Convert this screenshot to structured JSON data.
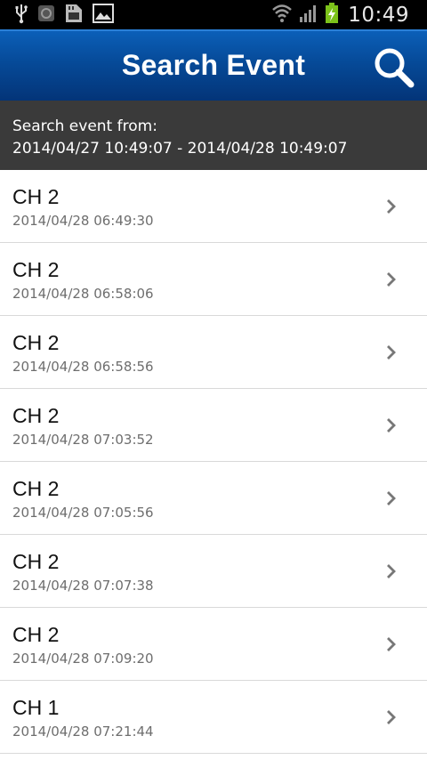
{
  "status_bar": {
    "time": "10:49",
    "icons": [
      "usb-icon",
      "notification-icon",
      "sd-card-icon",
      "image-icon",
      "wifi-icon",
      "signal-icon",
      "battery-charging-icon"
    ]
  },
  "header": {
    "title": "Search Event",
    "search_icon": "search-icon"
  },
  "range": {
    "label": "Search event from:",
    "value": "2014/04/27 10:49:07 - 2014/04/28 10:49:07"
  },
  "events": [
    {
      "channel": "CH 2",
      "time": "2014/04/28 06:49:30"
    },
    {
      "channel": "CH 2",
      "time": "2014/04/28 06:58:06"
    },
    {
      "channel": "CH 2",
      "time": "2014/04/28 06:58:56"
    },
    {
      "channel": "CH 2",
      "time": "2014/04/28 07:03:52"
    },
    {
      "channel": "CH 2",
      "time": "2014/04/28 07:05:56"
    },
    {
      "channel": "CH 2",
      "time": "2014/04/28 07:07:38"
    },
    {
      "channel": "CH 2",
      "time": "2014/04/28 07:09:20"
    },
    {
      "channel": "CH 1",
      "time": "2014/04/28 07:21:44"
    }
  ]
}
